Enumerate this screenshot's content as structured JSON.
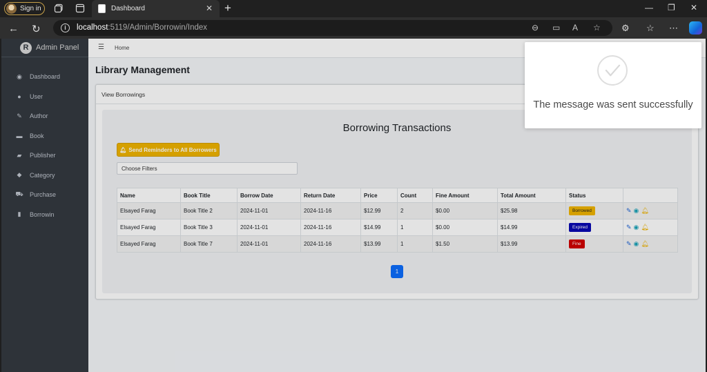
{
  "browser": {
    "signin_label": "Sign in",
    "tab_title": "Dashboard",
    "url_host": "localhost",
    "url_rest": ":5119/Admin/Borrowin/Index"
  },
  "sidebar": {
    "brand": "Admin Panel",
    "brand_logo": "R",
    "items": [
      {
        "icon": "dashboard-icon",
        "glyph": "◉",
        "label": "Dashboard"
      },
      {
        "icon": "user-icon",
        "glyph": "●",
        "label": "User"
      },
      {
        "icon": "edit-icon",
        "glyph": "✎",
        "label": "Author"
      },
      {
        "icon": "book-icon",
        "glyph": "▬",
        "label": "Book"
      },
      {
        "icon": "publisher-icon",
        "glyph": "▰",
        "label": "Publisher"
      },
      {
        "icon": "tag-icon",
        "glyph": "◆",
        "label": "Category"
      },
      {
        "icon": "cart-icon",
        "glyph": "⛟",
        "label": "Purchase"
      },
      {
        "icon": "bookmark-icon",
        "glyph": "▮",
        "label": "Borrowin"
      }
    ]
  },
  "topnav": {
    "home": "Home"
  },
  "page": {
    "title": "Library Management",
    "card_header": "View Borrowings",
    "heading": "Borrowing Transactions",
    "remind_button": "Send Reminders to All Borrowers",
    "filters_label": "Choose Filters"
  },
  "table": {
    "headers": [
      "Name",
      "Book Title",
      "Borrow Date",
      "Return Date",
      "Price",
      "Count",
      "Fine Amount",
      "Total Amount",
      "Status",
      ""
    ],
    "rows": [
      {
        "name": "Elsayed Farag",
        "book": "Book Title 2",
        "borrow": "2024-11-01",
        "return": "2024-11-16",
        "price": "$12.99",
        "count": "2",
        "fine": "$0.00",
        "total": "$25.98",
        "status": "Borrowed"
      },
      {
        "name": "Elsayed Farag",
        "book": "Book Title 3",
        "borrow": "2024-11-01",
        "return": "2024-11-16",
        "price": "$14.99",
        "count": "1",
        "fine": "$0.00",
        "total": "$14.99",
        "status": "Expired"
      },
      {
        "name": "Elsayed Farag",
        "book": "Book Title 7",
        "borrow": "2024-11-01",
        "return": "2024-11-16",
        "price": "$13.99",
        "count": "1",
        "fine": "$1.50",
        "total": "$13.99",
        "status": "Fine"
      }
    ]
  },
  "status_colors": {
    "Borrowed": "#f0b400",
    "Expired": "#0a0ab4",
    "Fine": "#d10000"
  },
  "pagination": {
    "current": "1"
  },
  "toast": {
    "message": "The message was sent successfully"
  }
}
